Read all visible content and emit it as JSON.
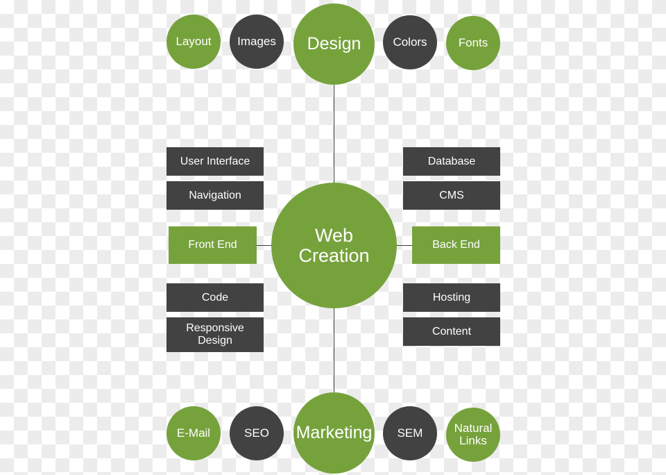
{
  "diagram": {
    "title": "Web Creation",
    "colors": {
      "green": "#76a23c",
      "dark": "#424242",
      "text": "#ffffff",
      "line": "#3a3a3a"
    },
    "center": {
      "label_line1": "Web",
      "label_line2": "Creation"
    },
    "top_branch": {
      "hub": "Design",
      "satellites": [
        {
          "label": "Layout",
          "color": "green"
        },
        {
          "label": "Images",
          "color": "dark"
        },
        {
          "label": "Colors",
          "color": "dark"
        },
        {
          "label": "Fonts",
          "color": "green"
        }
      ]
    },
    "bottom_branch": {
      "hub": "Marketing",
      "satellites": [
        {
          "label": "E-Mail",
          "color": "green"
        },
        {
          "label": "SEO",
          "color": "dark"
        },
        {
          "label": "SEM",
          "color": "dark"
        },
        {
          "label_line1": "Natural",
          "label_line2": "Links",
          "color": "green"
        }
      ]
    },
    "left_branch": {
      "hub": "Front End",
      "items": [
        {
          "label": "User Interface"
        },
        {
          "label": "Navigation"
        },
        {
          "label_line1": "Responsive",
          "label_line2": "Design"
        },
        {
          "label": "Code"
        }
      ]
    },
    "right_branch": {
      "hub": "Back End",
      "items": [
        {
          "label": "Database"
        },
        {
          "label": "CMS"
        },
        {
          "label": "Hosting"
        },
        {
          "label": "Content"
        }
      ]
    }
  }
}
